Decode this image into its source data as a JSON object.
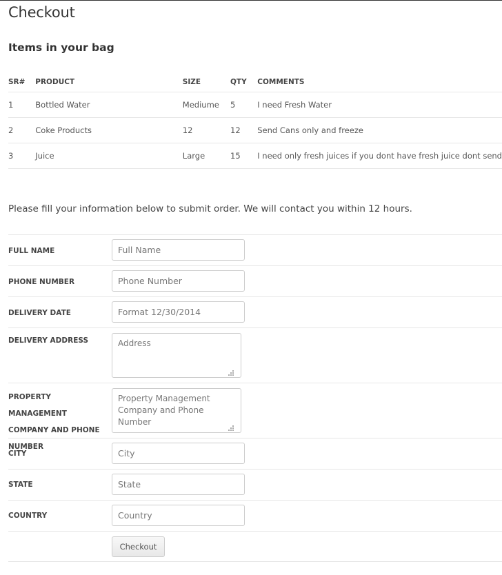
{
  "page": {
    "title": "Checkout",
    "section_title": "Items in your bag",
    "intro": "Please fill your information below to submit order. We will contact you within 12 hours."
  },
  "items_table": {
    "headers": {
      "sr": "SR#",
      "product": "PRODUCT",
      "size": "SIZE",
      "qty": "QTY",
      "comments": "COMMENTS"
    },
    "rows": [
      {
        "sr": "1",
        "product": "Bottled Water",
        "size": "Mediume",
        "qty": "5",
        "comments": "I need Fresh Water"
      },
      {
        "sr": "2",
        "product": "Coke Products",
        "size": "12",
        "qty": "12",
        "comments": "Send Cans only and freeze"
      },
      {
        "sr": "3",
        "product": "Juice",
        "size": "Large",
        "qty": "15",
        "comments": "I need only fresh juices if you dont have fresh juice dont send"
      }
    ]
  },
  "form": {
    "full_name": {
      "label": "FULL NAME",
      "placeholder": "Full Name"
    },
    "phone": {
      "label": "PHONE NUMBER",
      "placeholder": "Phone Number"
    },
    "delivery_date": {
      "label": "DELIVERY DATE",
      "placeholder": "Format 12/30/2014"
    },
    "delivery_address": {
      "label": "DELIVERY ADDRESS",
      "placeholder": "Address"
    },
    "property_mgmt": {
      "label": "PROPERTY MANAGEMENT COMPANY AND PHONE NUMBER",
      "placeholder": "Property Management Company and Phone Number"
    },
    "city": {
      "label": "CITY",
      "placeholder": "City"
    },
    "state": {
      "label": "STATE",
      "placeholder": "State"
    },
    "country": {
      "label": "COUNTRY",
      "placeholder": "Country"
    },
    "submit_label": "Checkout"
  }
}
